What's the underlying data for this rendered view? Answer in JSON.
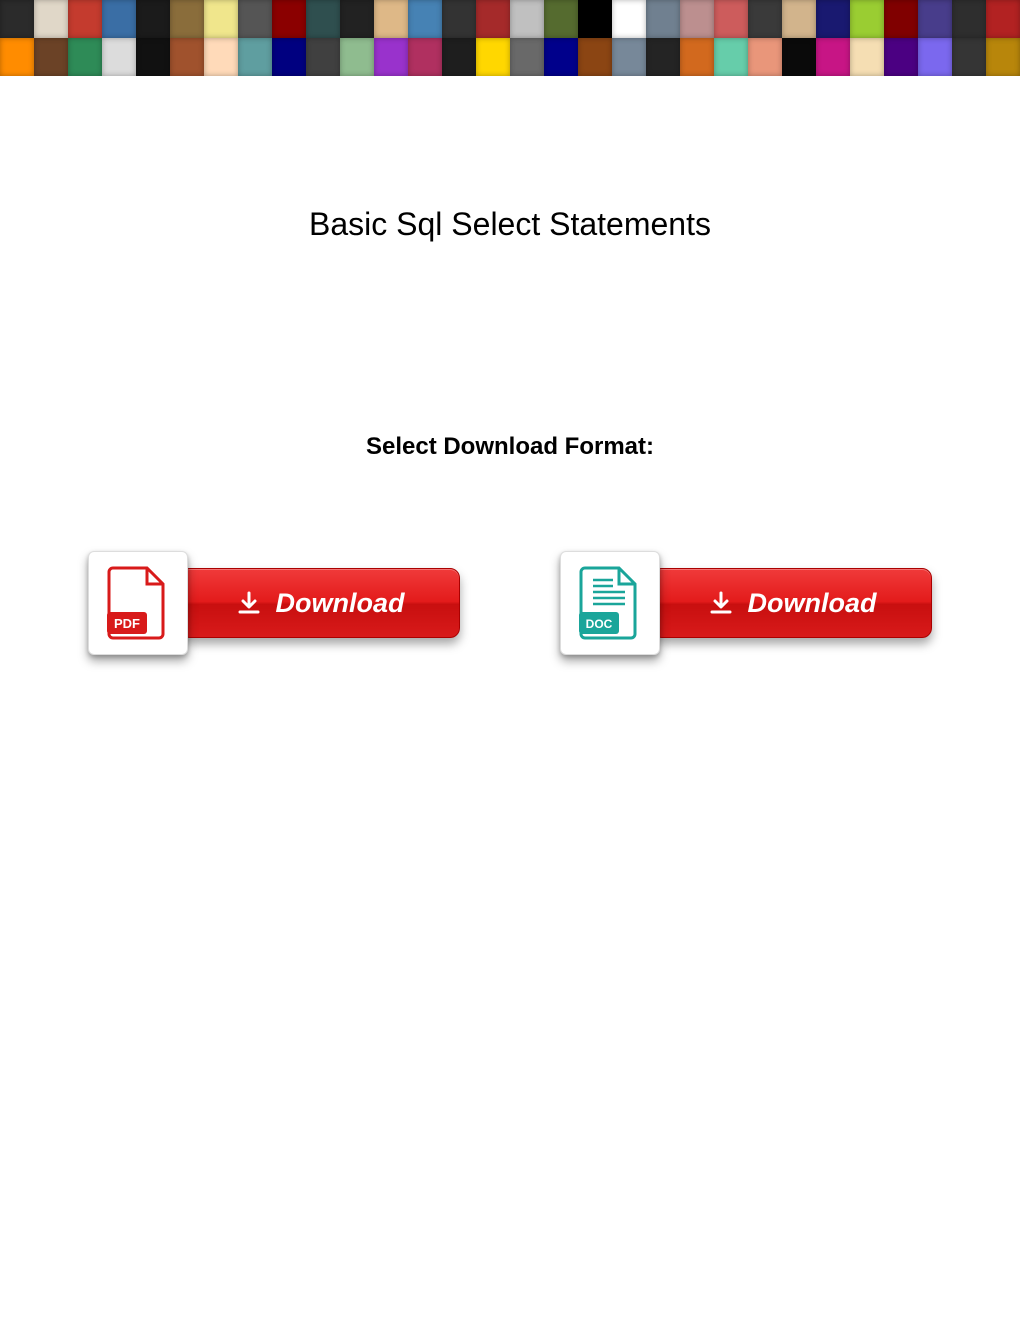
{
  "title": "Basic Sql Select Statements",
  "subtitle": "Select Download Format:",
  "downloads": {
    "pdf": {
      "label": "Download",
      "badge": "PDF"
    },
    "doc": {
      "label": "Download",
      "badge": "DOC"
    }
  },
  "banner_colors": [
    "#2b2b2b",
    "#e0d7c8",
    "#c43b2e",
    "#3a6ea5",
    "#1b1b1b",
    "#8a6d3b",
    "#f0e68c",
    "#555555",
    "#8b0000",
    "#2f4f4f",
    "#222222",
    "#deb887",
    "#4682b4",
    "#333333",
    "#a52a2a",
    "#c0c0c0",
    "#556b2f",
    "#000000",
    "#ffffff",
    "#708090",
    "#bc8f8f",
    "#cd5c5c",
    "#3a3a3a",
    "#d2b48c",
    "#191970",
    "#9acd32",
    "#800000",
    "#483d8b",
    "#2e2e2e",
    "#b22222",
    "#ff8c00",
    "#6b4226",
    "#2e8b57",
    "#dcdcdc",
    "#111111",
    "#a0522d",
    "#ffdab9",
    "#5f9ea0",
    "#000080",
    "#404040",
    "#8fbc8f",
    "#9932cc",
    "#b03060",
    "#1e1e1e",
    "#ffd700",
    "#696969",
    "#00008b",
    "#8b4513",
    "#778899",
    "#242424",
    "#d2691e",
    "#66cdaa",
    "#e9967a",
    "#0a0a0a",
    "#c71585",
    "#f5deb3",
    "#4b0082",
    "#7b68ee",
    "#353535",
    "#b8860b"
  ]
}
